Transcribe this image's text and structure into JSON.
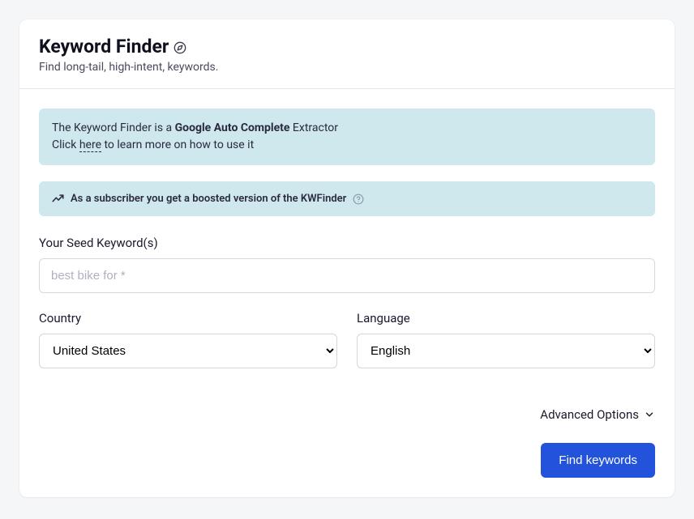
{
  "header": {
    "title": "Keyword Finder",
    "subtitle": "Find long-tail, high-intent, keywords."
  },
  "info_banner": {
    "prefix": "The Keyword Finder is a ",
    "bold": "Google Auto Complete",
    "suffix": " Extractor",
    "line2_prefix": "Click ",
    "line2_link": "here",
    "line2_suffix": " to learn more on how to use it"
  },
  "boost_banner": {
    "text": "As a subscriber you get a boosted version of the KWFinder"
  },
  "form": {
    "seed_label": "Your Seed Keyword(s)",
    "seed_placeholder": "best bike for *",
    "country_label": "Country",
    "country_value": "United States",
    "language_label": "Language",
    "language_value": "English"
  },
  "advanced_label": "Advanced Options",
  "submit_label": "Find keywords"
}
